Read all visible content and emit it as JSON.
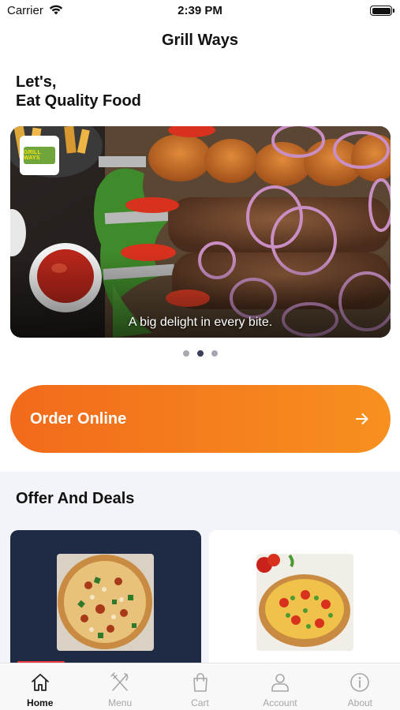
{
  "status_bar": {
    "carrier": "Carrier",
    "time": "2:39 PM"
  },
  "nav": {
    "title": "Grill Ways"
  },
  "greeting": {
    "line1": "Let's,",
    "line2": "Eat Quality Food"
  },
  "banner": {
    "logo_text": "GRILL WAYS",
    "caption": "A big delight in every bite.",
    "dot_count": 3,
    "active_dot": 1
  },
  "order": {
    "label": "Order Online"
  },
  "offers": {
    "title": "Offer And Deals"
  },
  "tabs": [
    {
      "label": "Home",
      "icon": "home-icon",
      "active": true
    },
    {
      "label": "Menu",
      "icon": "fork-knife-icon",
      "active": false
    },
    {
      "label": "Cart",
      "icon": "bag-icon",
      "active": false
    },
    {
      "label": "Account",
      "icon": "person-icon",
      "active": false
    },
    {
      "label": "About",
      "icon": "info-icon",
      "active": false
    }
  ],
  "colors": {
    "accent_start": "#f26a1b",
    "accent_end": "#f7901f",
    "deal_dark": "#1f2a44",
    "section_bg": "#f2f4f9",
    "active_tab": "#111111",
    "inactive_tab": "#a6a6a6"
  }
}
